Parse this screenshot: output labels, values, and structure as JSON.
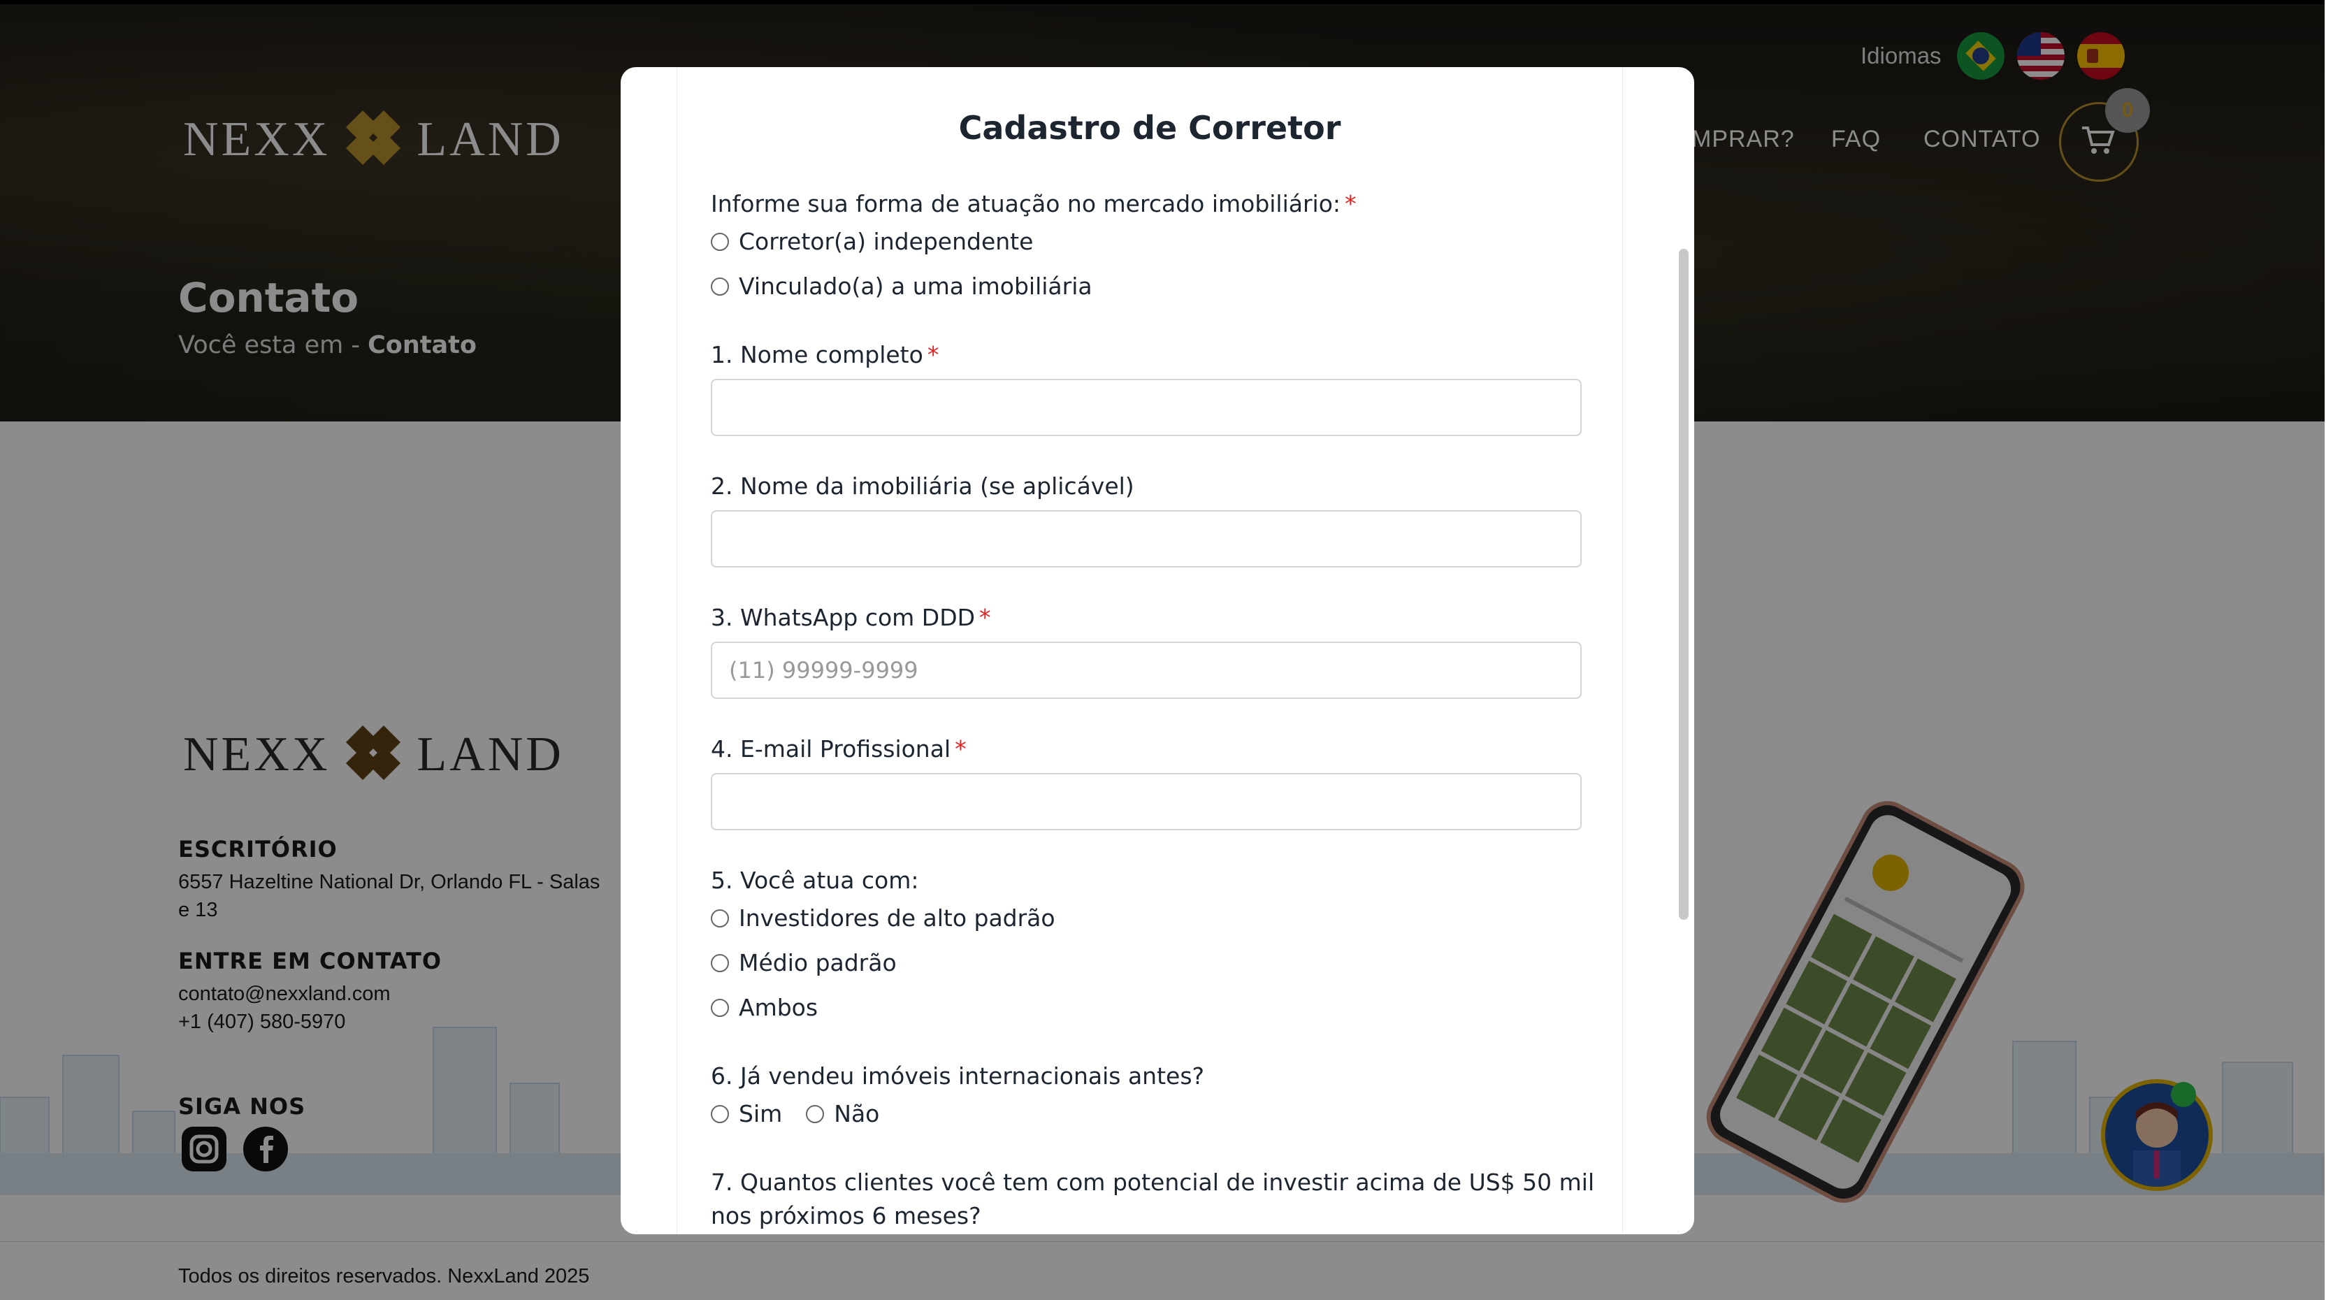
{
  "header": {
    "languages_label": "Idiomas",
    "flags": [
      "brazil-flag-icon",
      "usa-flag-icon",
      "spain-flag-icon"
    ],
    "brand": {
      "left": "NEXX",
      "right": "LAND"
    },
    "nav": {
      "comprar": "MPRAR?",
      "faq": "FAQ",
      "contato": "CONTATO"
    },
    "cart_count": "0"
  },
  "hero": {
    "title": "Contato",
    "breadcrumb_prefix": "Você esta em - ",
    "breadcrumb_current": "Contato"
  },
  "footer": {
    "brand": {
      "left": "NEXX",
      "right": "LAND"
    },
    "office_heading": "ESCRITÓRIO",
    "office_address": "6557 Hazeltine National Dr, Orlando FL - Salas",
    "office_address_2": "e 13",
    "contact_heading": "ENTRE EM CONTATO",
    "email": "contato@nexxland.com",
    "phone": "+1 (407) 580-5970",
    "social_heading": "SIGA NOS",
    "copyright": "Todos os direitos reservados. NexxLand 2025"
  },
  "modal": {
    "title": "Cadastro de Corretor",
    "q_role": "Informe sua forma de atuação no mercado imobiliário:",
    "role_options": [
      "Corretor(a) independente",
      "Vinculado(a) a uma imobiliária"
    ],
    "q1": "1. Nome completo",
    "q2": "2. Nome da imobiliária (se aplicável)",
    "q3": "3. WhatsApp com DDD",
    "q3_placeholder": "(11) 99999-9999",
    "q4": "4. E-mail Profissional",
    "q5": "5. Você atua com:",
    "q5_options": [
      "Investidores de alto padrão",
      "Médio padrão",
      "Ambos"
    ],
    "q6": "6. Já vendeu imóveis internacionais antes?",
    "q6_options": [
      "Sim",
      "Não"
    ],
    "q7": "7. Quantos clientes você tem com potencial de investir acima de US$ 50 mil nos próximos 6 meses?",
    "required_mark": "*"
  },
  "colors": {
    "accent_gold": "#b8922e",
    "required": "#e02424",
    "text": "#1d2530"
  }
}
